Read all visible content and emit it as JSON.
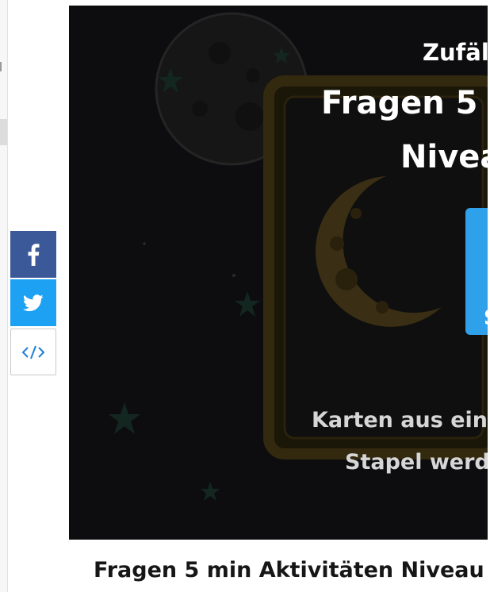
{
  "sidebar": {
    "share": {
      "facebook_icon": "facebook-f",
      "twitter_icon": "twitter-bird",
      "embed_icon": "code-brackets",
      "facebook_color": "#3b5998",
      "twitter_color": "#1da1f2",
      "embed_glyph": "</>"
    }
  },
  "card": {
    "subtitle": "Zufäl",
    "title_line1": "Fragen 5 m",
    "title_line2": "Nivea",
    "start_button_label": "S",
    "footer_line1": "Karten aus ein",
    "footer_line2": "Stapel werd"
  },
  "caption": {
    "title": "Fragen 5 min Aktivitäten Niveau"
  },
  "colors": {
    "card_background": "#0d0d0f",
    "accent_button": "#2fa1ea",
    "moon_dim": "#3a2e14",
    "frame_dim": "#33290f"
  }
}
